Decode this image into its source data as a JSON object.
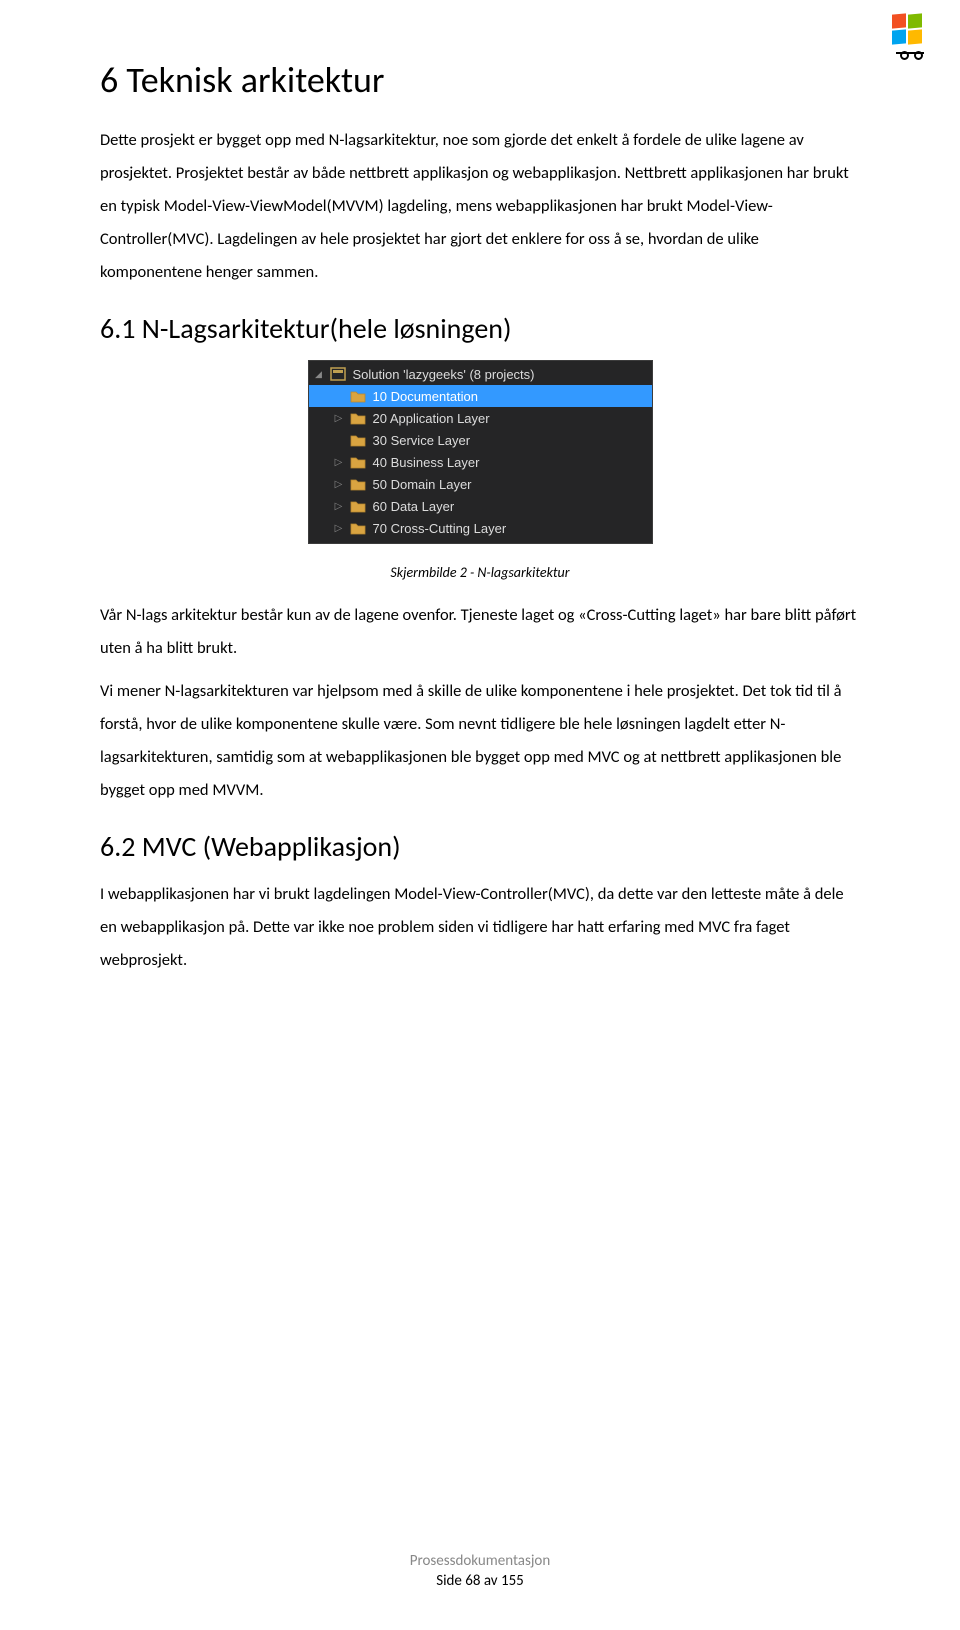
{
  "heading1": "6  Teknisk arkitektur",
  "para1": "Dette prosjekt er bygget opp med N-lagsarkitektur, noe som gjorde det enkelt å fordele de ulike lagene av prosjektet. Prosjektet består av både nettbrett applikasjon og webapplikasjon. Nettbrett applikasjonen har brukt en typisk Model-View-ViewModel(MVVM) lagdeling, mens webapplikasjonen har brukt Model-View-Controller(MVC). Lagdelingen av hele prosjektet har gjort det enklere for oss å se, hvordan de ulike komponentene henger sammen.",
  "heading2": "6.1  N-Lagsarkitektur(hele løsningen)",
  "ide": {
    "solution_label": "Solution 'lazygeeks' (8 projects)",
    "items": [
      {
        "label": "10 Documentation",
        "selected": true,
        "expandable": false
      },
      {
        "label": "20 Application Layer",
        "selected": false,
        "expandable": true
      },
      {
        "label": "30 Service Layer",
        "selected": false,
        "expandable": false
      },
      {
        "label": "40 Business Layer",
        "selected": false,
        "expandable": true
      },
      {
        "label": "50 Domain Layer",
        "selected": false,
        "expandable": true
      },
      {
        "label": "60 Data Layer",
        "selected": false,
        "expandable": true
      },
      {
        "label": "70 Cross-Cutting Layer",
        "selected": false,
        "expandable": true
      }
    ]
  },
  "caption": "Skjermbilde 2 - N-lagsarkitektur",
  "para2": "Vår N-lags arkitektur består kun av de lagene ovenfor. Tjeneste laget og «Cross-Cutting laget» har bare blitt påført uten å ha blitt brukt.",
  "para3": "Vi mener N-lagsarkitekturen var hjelpsom med å skille de ulike komponentene i hele prosjektet. Det tok tid til å forstå, hvor de ulike komponentene skulle være. Som nevnt tidligere ble hele løsningen lagdelt etter N-lagsarkitekturen, samtidig som at webapplikasjonen ble bygget opp med MVC og at nettbrett applikasjonen ble bygget opp med MVVM.",
  "heading3": "6.2  MVC (Webapplikasjon)",
  "para4": "I webapplikasjonen har vi brukt lagdelingen Model-View-Controller(MVC), da dette var den letteste måte å dele en webapplikasjon på. Dette var ikke noe problem siden vi tidligere har hatt erfaring med MVC fra faget webprosjekt.",
  "footer_title": "Prosessdokumentasjon",
  "footer_page": "Side 68 av 155"
}
